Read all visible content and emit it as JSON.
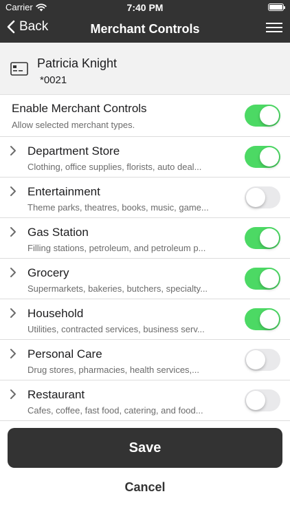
{
  "status_bar": {
    "carrier": "Carrier",
    "time": "7:40 PM"
  },
  "nav": {
    "back_label": "Back",
    "title": "Merchant Controls"
  },
  "card": {
    "name": "Patricia Knight",
    "number": "*0021"
  },
  "enable": {
    "title": "Enable Merchant Controls",
    "subtitle": "Allow selected merchant types.",
    "enabled": true
  },
  "categories": [
    {
      "title": "Department Store",
      "subtitle": "Clothing, office supplies, florists, auto deal...",
      "enabled": true
    },
    {
      "title": "Entertainment",
      "subtitle": "Theme parks, theatres, books, music, game...",
      "enabled": false
    },
    {
      "title": "Gas Station",
      "subtitle": "Filling stations, petroleum, and petroleum p...",
      "enabled": true
    },
    {
      "title": "Grocery",
      "subtitle": "Supermarkets, bakeries, butchers, specialty...",
      "enabled": true
    },
    {
      "title": "Household",
      "subtitle": "Utilities, contracted services, business serv...",
      "enabled": true
    },
    {
      "title": "Personal Care",
      "subtitle": "Drug stores, pharmacies, health services,...",
      "enabled": false
    },
    {
      "title": "Restaurant",
      "subtitle": "Cafes, coffee, fast food, catering, and food...",
      "enabled": false
    }
  ],
  "actions": {
    "save_label": "Save",
    "cancel_label": "Cancel"
  },
  "colors": {
    "bar": "#333333",
    "toggle_on": "#4cd964",
    "toggle_off": "#e9e9eb"
  },
  "icons": [
    "wifi-icon",
    "battery-icon",
    "back-chevron-icon",
    "hamburger-menu-icon",
    "credit-card-icon",
    "chevron-right-icon"
  ]
}
